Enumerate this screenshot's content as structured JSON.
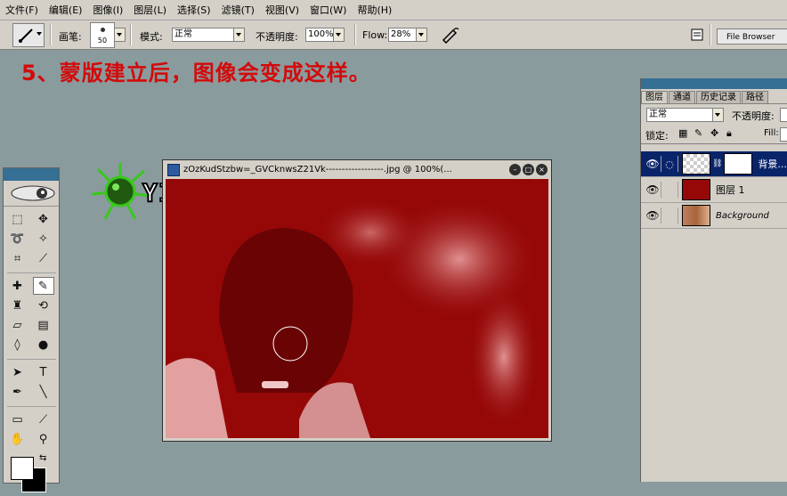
{
  "menu": [
    "文件(F)",
    "编辑(E)",
    "图像(I)",
    "图层(L)",
    "选择(S)",
    "滤镜(T)",
    "视图(V)",
    "窗口(W)",
    "帮助(H)"
  ],
  "options": {
    "brush_label": "画笔:",
    "brush_size": "50",
    "mode_label": "模式:",
    "mode_value": "正常",
    "opacity_label": "不透明度:",
    "opacity_value": "100%",
    "flow_label": "Flow:",
    "flow_value": "28%",
    "file_browser_tab": "File Browser"
  },
  "caption": "5、蒙版建立后，图像会变成这样。",
  "watermark": "YINYIN",
  "document": {
    "title": "zOzKudStzbw=_GVCknwsZ21Vk------------------.jpg @ 100%(..."
  },
  "layers_panel": {
    "tabs": [
      "图层",
      "通道",
      "历史记录",
      "路径"
    ],
    "blend_mode": "正常",
    "opacity_label": "不透明度:",
    "lock_label": "锁定:",
    "fill_label": "Fill:",
    "layers": [
      {
        "name": "背景...",
        "selected": true,
        "thumb_color": "#ffffff"
      },
      {
        "name": "图层 1",
        "selected": false,
        "thumb_color": "#960808"
      },
      {
        "name": "Background",
        "selected": false,
        "thumb_color": "#a5643a"
      }
    ]
  },
  "colors": {
    "canvas": "#960808",
    "caption": "#d30a0a",
    "selected_layer": "#0a246a"
  }
}
